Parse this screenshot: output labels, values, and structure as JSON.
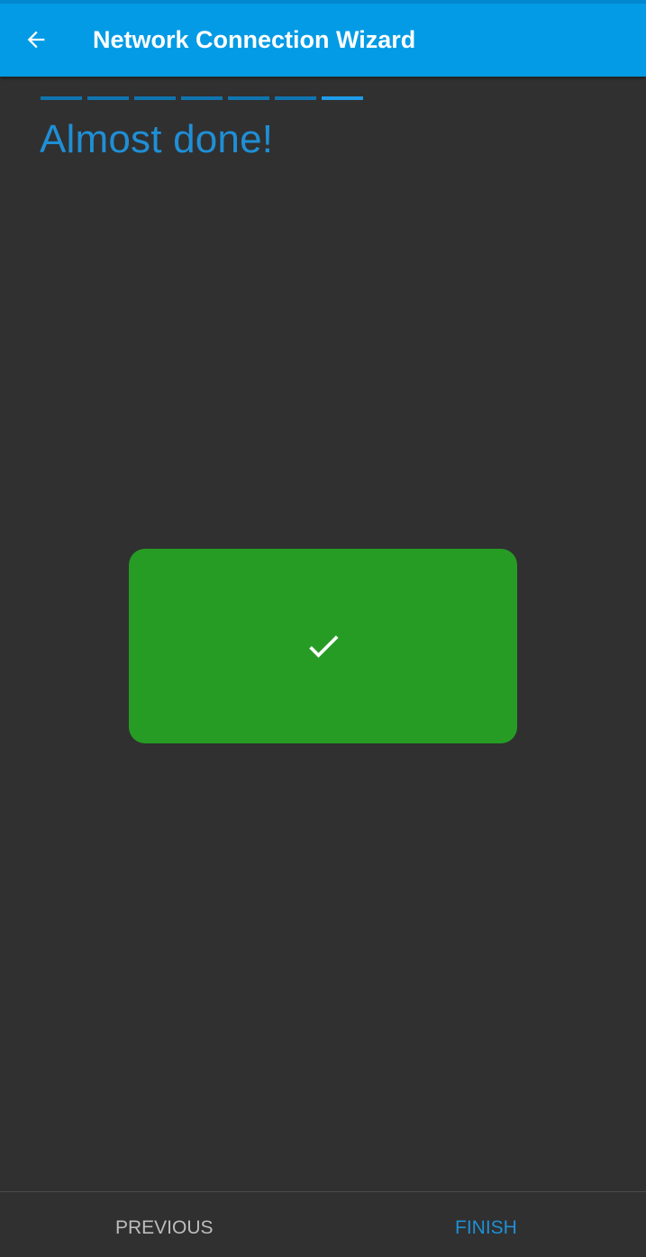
{
  "app_bar": {
    "title": "Network Connection Wizard",
    "back_icon": "arrow-left-icon",
    "color": "#039BE5"
  },
  "wizard": {
    "step_count": 7,
    "current_step": 7,
    "title": "Almost done!"
  },
  "success": {
    "icon": "checkmark-icon",
    "color": "#269C25"
  },
  "footer": {
    "previous_label": "PREVIOUS",
    "finish_label": "FINISH"
  },
  "colors": {
    "accent": "#1F8FD6",
    "background": "#303030"
  }
}
